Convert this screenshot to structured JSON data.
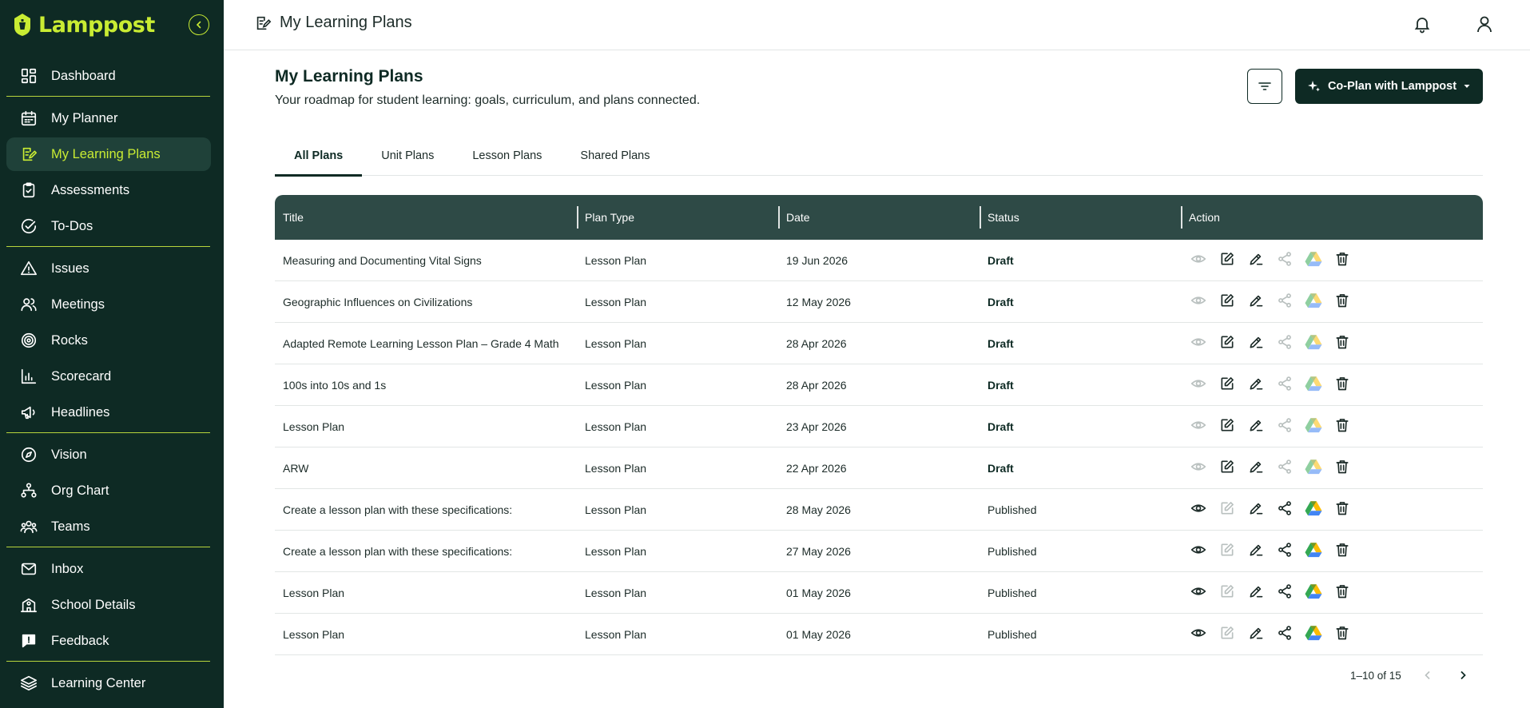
{
  "brand": {
    "name": "Lamppost",
    "accent": "#c9ec33",
    "sidebar_bg": "#0e2a24"
  },
  "sidebar": {
    "groups": [
      [
        {
          "label": "Dashboard",
          "icon": "dashboard-icon"
        }
      ],
      [
        {
          "label": "My Planner",
          "icon": "calendar-icon"
        },
        {
          "label": "My Learning Plans",
          "icon": "edit-note-icon",
          "active": true
        },
        {
          "label": "Assessments",
          "icon": "clipboard-check-icon"
        },
        {
          "label": "To-Dos",
          "icon": "check-circle-icon"
        }
      ],
      [
        {
          "label": "Issues",
          "icon": "warning-icon"
        },
        {
          "label": "Meetings",
          "icon": "people-icon"
        },
        {
          "label": "Rocks",
          "icon": "target-icon"
        },
        {
          "label": "Scorecard",
          "icon": "bar-chart-icon"
        },
        {
          "label": "Headlines",
          "icon": "megaphone-icon"
        }
      ],
      [
        {
          "label": "Vision",
          "icon": "compass-icon"
        },
        {
          "label": "Org Chart",
          "icon": "org-chart-icon"
        },
        {
          "label": "Teams",
          "icon": "team-icon"
        }
      ],
      [
        {
          "label": "Inbox",
          "icon": "mail-icon"
        },
        {
          "label": "School Details",
          "icon": "school-icon"
        },
        {
          "label": "Feedback",
          "icon": "feedback-icon"
        }
      ],
      [
        {
          "label": "Learning Center",
          "icon": "layers-icon"
        }
      ]
    ]
  },
  "topbar": {
    "title": "My Learning Plans"
  },
  "main": {
    "title": "My Learning Plans",
    "subtitle": "Your roadmap for student learning: goals, curriculum, and plans connected.",
    "coplan_label": "Co-Plan with Lamppost",
    "tabs": [
      "All Plans",
      "Unit Plans",
      "Lesson Plans",
      "Shared Plans"
    ],
    "active_tab": 0
  },
  "table": {
    "headers": [
      "Title",
      "Plan Type",
      "Date",
      "Status",
      "Action"
    ],
    "rows": [
      {
        "title": "Measuring and Documenting Vital Signs",
        "type": "Lesson Plan",
        "date": "19 Jun 2026",
        "status": "Draft"
      },
      {
        "title": "Geographic Influences on Civilizations",
        "type": "Lesson Plan",
        "date": "12 May 2026",
        "status": "Draft"
      },
      {
        "title": "Adapted Remote Learning Lesson Plan – Grade 4 Math",
        "type": "Lesson Plan",
        "date": "28 Apr 2026",
        "status": "Draft"
      },
      {
        "title": "100s into 10s and 1s",
        "type": "Lesson Plan",
        "date": "28 Apr 2026",
        "status": "Draft"
      },
      {
        "title": "Lesson Plan",
        "type": "Lesson Plan",
        "date": "23 Apr 2026",
        "status": "Draft"
      },
      {
        "title": "ARW",
        "type": "Lesson Plan",
        "date": "22 Apr 2026",
        "status": "Draft"
      },
      {
        "title": "Create a lesson plan with these specifications:",
        "type": "Lesson Plan",
        "date": "28 May 2026",
        "status": "Published"
      },
      {
        "title": "Create a lesson plan with these specifications:",
        "type": "Lesson Plan",
        "date": "27 May 2026",
        "status": "Published"
      },
      {
        "title": "Lesson Plan",
        "type": "Lesson Plan",
        "date": "01 May 2026",
        "status": "Published"
      },
      {
        "title": "Lesson Plan",
        "type": "Lesson Plan",
        "date": "01 May 2026",
        "status": "Published"
      }
    ]
  },
  "pagination": {
    "range": "1–10 of 15"
  }
}
